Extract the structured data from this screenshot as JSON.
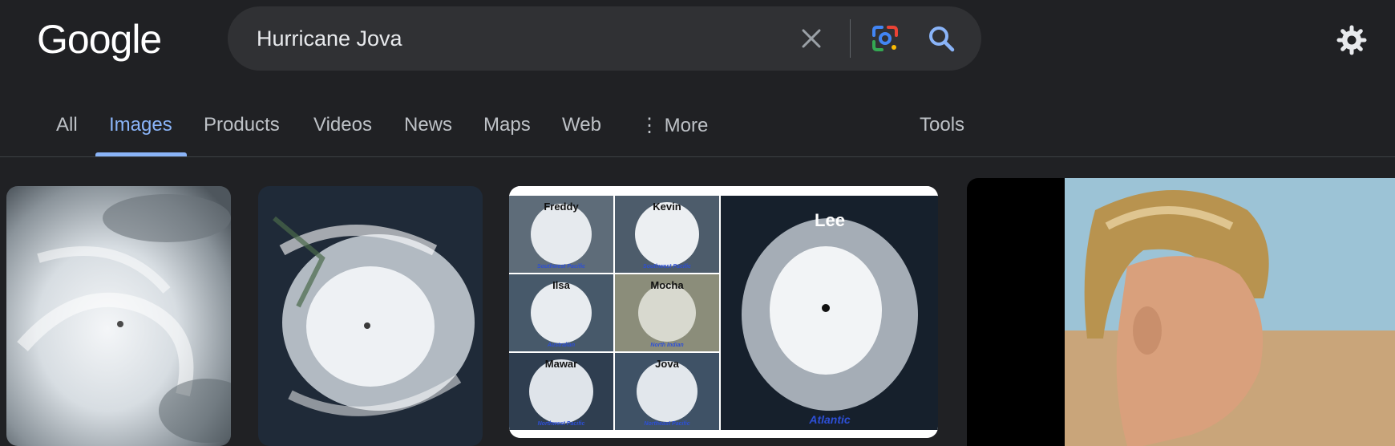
{
  "brand": {
    "logo_text": "Google"
  },
  "search": {
    "query": "Hurricane Jova"
  },
  "icons": {
    "clear": "close-icon",
    "lens": "camera-lens-icon",
    "search": "search-icon",
    "settings": "gear-icon",
    "more": "vertical-dots-icon"
  },
  "nav": {
    "tabs": [
      {
        "label": "All"
      },
      {
        "label": "Images",
        "active": true
      },
      {
        "label": "Products"
      },
      {
        "label": "Videos"
      },
      {
        "label": "News"
      },
      {
        "label": "Maps"
      },
      {
        "label": "Web"
      },
      {
        "label": "⋮ More"
      }
    ],
    "tools_label": "Tools"
  },
  "results": {
    "collage_labels": [
      "Freddy",
      "Kevin",
      "Ilsa",
      "Mocha",
      "Mawar",
      "Jova",
      "Lee"
    ],
    "collage_regions": [
      "Southwest Pacific",
      "Southwest Pacific",
      "Australian",
      "North Indian",
      "Northwest Pacific",
      "Northeast Pacific",
      "Atlantic"
    ]
  },
  "colors": {
    "background": "#202124",
    "searchbox": "#303134",
    "accent": "#8ab4f8",
    "tab_text": "#bdc1c6"
  }
}
